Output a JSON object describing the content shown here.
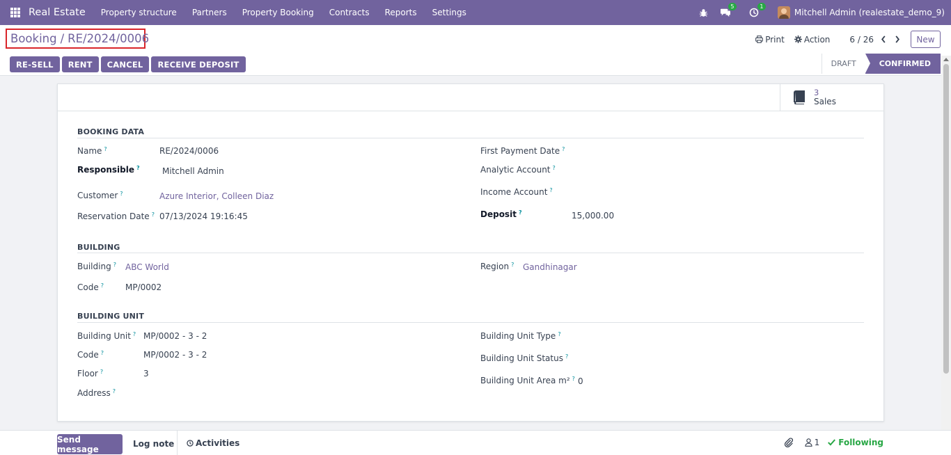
{
  "navbar": {
    "brand": "Real Estate",
    "menu": [
      "Property structure",
      "Partners",
      "Property Booking",
      "Contracts",
      "Reports",
      "Settings"
    ],
    "messages_badge": "5",
    "activities_badge": "1",
    "user": "Mitchell Admin (realestate_demo_9)"
  },
  "control": {
    "breadcrumb_parent": "Booking",
    "breadcrumb_sep": "/",
    "breadcrumb_current": "RE/2024/0006",
    "print_label": "Print",
    "action_label": "Action",
    "pager": "6 / 26",
    "new_label": "New"
  },
  "actions": [
    "RE-SELL",
    "RENT",
    "CANCEL",
    "RECEIVE DEPOSIT"
  ],
  "status": {
    "draft": "DRAFT",
    "confirmed": "CONFIRMED"
  },
  "smart_button": {
    "count": "3",
    "label": "Sales"
  },
  "booking": {
    "title": "BOOKING DATA",
    "name_label": "Name",
    "name": "RE/2024/0006",
    "responsible_label": "Responsible",
    "responsible": "Mitchell Admin",
    "customer_label": "Customer",
    "customer": "Azure Interior, Colleen Diaz",
    "reservation_label": "Reservation Date",
    "reservation": "07/13/2024 19:16:45",
    "first_payment_label": "First Payment Date",
    "analytic_label": "Analytic Account",
    "income_label": "Income Account",
    "deposit_label": "Deposit",
    "deposit": "15,000.00"
  },
  "building": {
    "title": "BUILDING",
    "building_label": "Building",
    "building": "ABC World",
    "code_label": "Code",
    "code": "MP/0002",
    "region_label": "Region",
    "region": "Gandhinagar"
  },
  "unit": {
    "title": "BUILDING UNIT",
    "unit_label": "Building Unit",
    "unit": "MP/0002 - 3 - 2",
    "code_label": "Code",
    "code": "MP/0002 - 3 - 2",
    "floor_label": "Floor",
    "floor": "3",
    "address_label": "Address",
    "type_label": "Building Unit Type",
    "status_label": "Building Unit Status",
    "area_label": "Building Unit Area m²",
    "area": "0"
  },
  "help_mark": "?",
  "chatter": {
    "send_message": "Send message",
    "log_note": "Log note",
    "activities": "Activities",
    "followers_count": "1",
    "following": "Following"
  },
  "colors": {
    "primary": "#71639e",
    "success": "#28a745",
    "highlight": "#d9252a"
  }
}
